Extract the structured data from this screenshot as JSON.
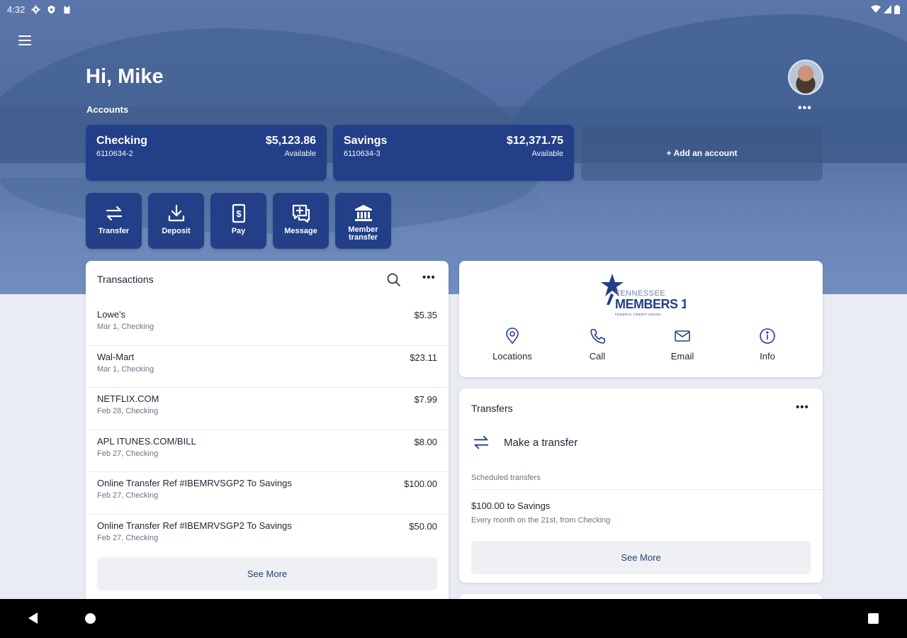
{
  "status_bar": {
    "time": "4:32",
    "left_icons": [
      "gear-icon",
      "shield-icon",
      "clipboard-icon"
    ],
    "right_icons": [
      "wifi-icon",
      "signal-icon",
      "battery-icon"
    ]
  },
  "header": {
    "greeting": "Hi, Mike",
    "accounts_label": "Accounts",
    "more_label": "•••"
  },
  "accounts": [
    {
      "name": "Checking",
      "number": "6110634-2",
      "balance": "$5,123.86",
      "balance_label": "Available"
    },
    {
      "name": "Savings",
      "number": "6110634-3",
      "balance": "$12,371.75",
      "balance_label": "Available"
    }
  ],
  "add_account_label": "+ Add an account",
  "quick_actions": [
    {
      "label": "Transfer",
      "icon": "transfer-icon"
    },
    {
      "label": "Deposit",
      "icon": "deposit-icon"
    },
    {
      "label": "Pay",
      "icon": "bill-icon"
    },
    {
      "label": "Message",
      "icon": "message-icon"
    },
    {
      "label": "Member transfer",
      "icon": "bank-icon"
    }
  ],
  "transactions": {
    "title": "Transactions",
    "more_label": "•••",
    "items": [
      {
        "name": "Lowe's",
        "detail": "Mar 1, Checking",
        "amount": "$5.35"
      },
      {
        "name": "Wal-Mart",
        "detail": "Mar 1, Checking",
        "amount": "$23.11"
      },
      {
        "name": "NETFLIX.COM",
        "detail": "Feb 28, Checking",
        "amount": "$7.99"
      },
      {
        "name": "APL ITUNES.COM/BILL",
        "detail": "Feb 27, Checking",
        "amount": "$8.00"
      },
      {
        "name": "Online Transfer Ref #IBEMRVSGP2 To Savings",
        "detail": "Feb 27, Checking",
        "amount": "$100.00"
      },
      {
        "name": "Online Transfer Ref #IBEMRVSGP2 To Savings",
        "detail": "Feb 27, Checking",
        "amount": "$50.00"
      }
    ],
    "see_more": "See More"
  },
  "credit_union": {
    "logo": {
      "line1": "TENNESSEE",
      "line2": "MEMBERS 1ST",
      "line3": "FEDERAL CREDIT UNION"
    },
    "actions": [
      {
        "label": "Locations",
        "icon": "location-pin-icon"
      },
      {
        "label": "Call",
        "icon": "phone-icon"
      },
      {
        "label": "Email",
        "icon": "email-icon"
      },
      {
        "label": "Info",
        "icon": "info-icon"
      }
    ]
  },
  "transfers": {
    "title": "Transfers",
    "more_label": "•••",
    "make_transfer": "Make a transfer",
    "scheduled_label": "Scheduled transfers",
    "scheduled": [
      {
        "title": "$100.00 to Savings",
        "detail": "Every month on the 21st, from Checking"
      }
    ],
    "see_more": "See More"
  },
  "colors": {
    "brand_navy": "#223f87",
    "page_bg": "#e9ecf2",
    "card_bg": "#ffffff"
  }
}
